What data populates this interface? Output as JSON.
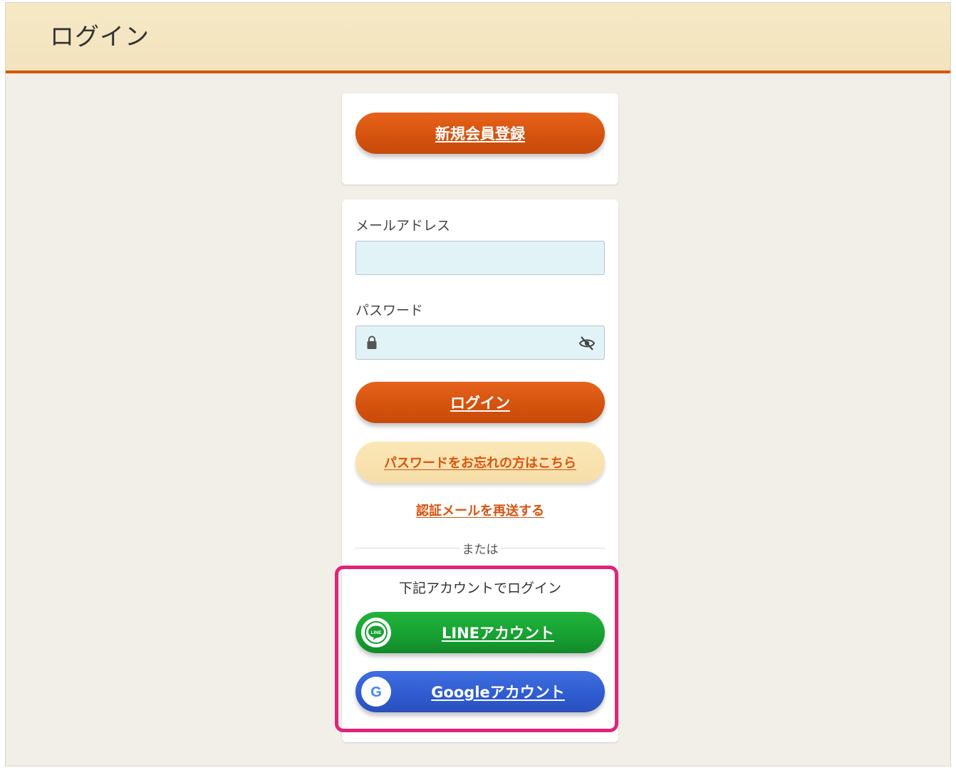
{
  "header": {
    "title": "ログイン"
  },
  "register": {
    "label": "新規会員登録"
  },
  "login_form": {
    "email_label": "メールアドレス",
    "email_value": "",
    "password_label": "パスワード",
    "password_value": "",
    "login_button": "ログイン",
    "forgot_password": "パスワードをお忘れの方はこちら",
    "resend_mail": "認証メールを再送する",
    "divider_text": "または"
  },
  "social": {
    "caption": "下記アカウントでログイン",
    "line_label": "LINEアカウント",
    "line_icon_text": "LINE",
    "google_label": "Googleアカウント",
    "google_icon_text": "G"
  },
  "colors": {
    "accent_orange": "#d9530f",
    "line_green": "#17a031",
    "google_blue": "#2f5bd0",
    "highlight_pink": "#e0247a"
  },
  "icons": {
    "lock": "lock-icon",
    "eye": "eye-off-icon",
    "line": "line-logo-icon",
    "google": "google-logo-icon"
  }
}
